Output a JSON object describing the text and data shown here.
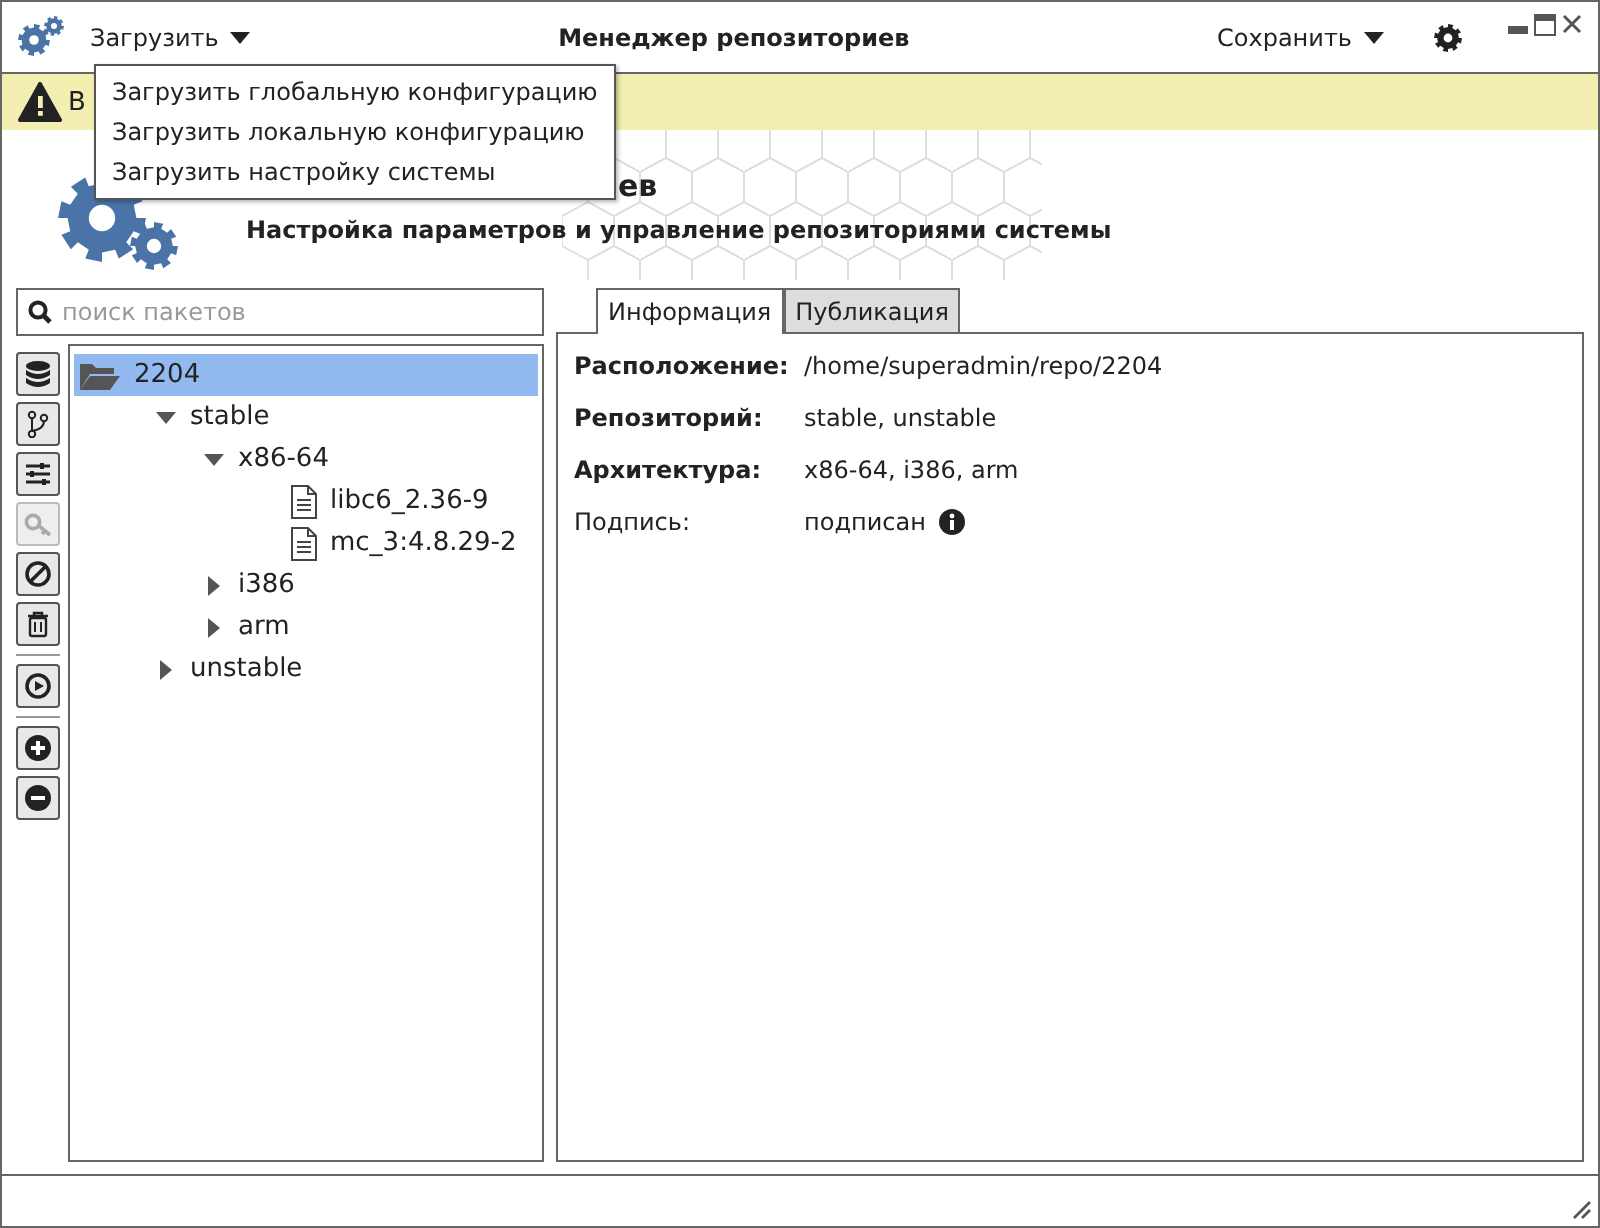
{
  "window": {
    "title": "Менеджер репозиториев"
  },
  "menu_bar": {
    "load_menu": {
      "label": "Загрузить",
      "expanded": true,
      "items": [
        {
          "label": "Загрузить глобальную конфигурацию"
        },
        {
          "label": "Загрузить локальную конфигурацию"
        },
        {
          "label": "Загрузить настройку системы"
        }
      ]
    },
    "save_menu": {
      "label": "Сохранить"
    }
  },
  "banner": {
    "text": "В"
  },
  "header": {
    "title": "ев",
    "subtitle": "Настройка параметров и управление репозиториями системы"
  },
  "search": {
    "placeholder": "поиск пакетов"
  },
  "toolbar": [
    {
      "kind": "database",
      "disabled": false
    },
    {
      "kind": "branch",
      "disabled": false
    },
    {
      "kind": "sliders",
      "disabled": false
    },
    {
      "kind": "key",
      "disabled": true
    },
    {
      "kind": "ban",
      "disabled": false
    },
    {
      "kind": "trash",
      "disabled": false
    },
    {
      "kind": "separator"
    },
    {
      "kind": "play",
      "disabled": false
    },
    {
      "kind": "separator"
    },
    {
      "kind": "plus",
      "disabled": false
    },
    {
      "kind": "minus",
      "disabled": false
    }
  ],
  "tree": [
    {
      "label": "2204",
      "kind": "folder",
      "selected": true,
      "expanded": true,
      "children": [
        {
          "label": "stable",
          "kind": "group",
          "selected": false,
          "expanded": true,
          "children": [
            {
              "label": "x86-64",
              "kind": "group",
              "selected": false,
              "expanded": true,
              "children": [
                {
                  "label": "libc6_2.36-9",
                  "kind": "file",
                  "selected": false
                },
                {
                  "label": "mc_3:4.8.29-2",
                  "kind": "file",
                  "selected": false
                }
              ]
            },
            {
              "label": "i386",
              "kind": "group",
              "selected": false,
              "expanded": false
            },
            {
              "label": "arm",
              "kind": "group",
              "selected": false,
              "expanded": false
            }
          ]
        },
        {
          "label": "unstable",
          "kind": "group",
          "selected": false,
          "expanded": false
        }
      ]
    }
  ],
  "tabs": [
    {
      "label": "Информация",
      "selected": true
    },
    {
      "label": "Публикация",
      "selected": false
    }
  ],
  "details": [
    {
      "label": "Расположение:",
      "value": "/home/superadmin/repo/2204",
      "bold": true
    },
    {
      "label": "Репозиторий:",
      "value": "stable, unstable",
      "bold": true
    },
    {
      "label": "Архитектура:",
      "value": "x86-64, i386, arm",
      "bold": true
    },
    {
      "label": "Подпись:",
      "value": "подписан",
      "bold": false,
      "info": true
    }
  ]
}
